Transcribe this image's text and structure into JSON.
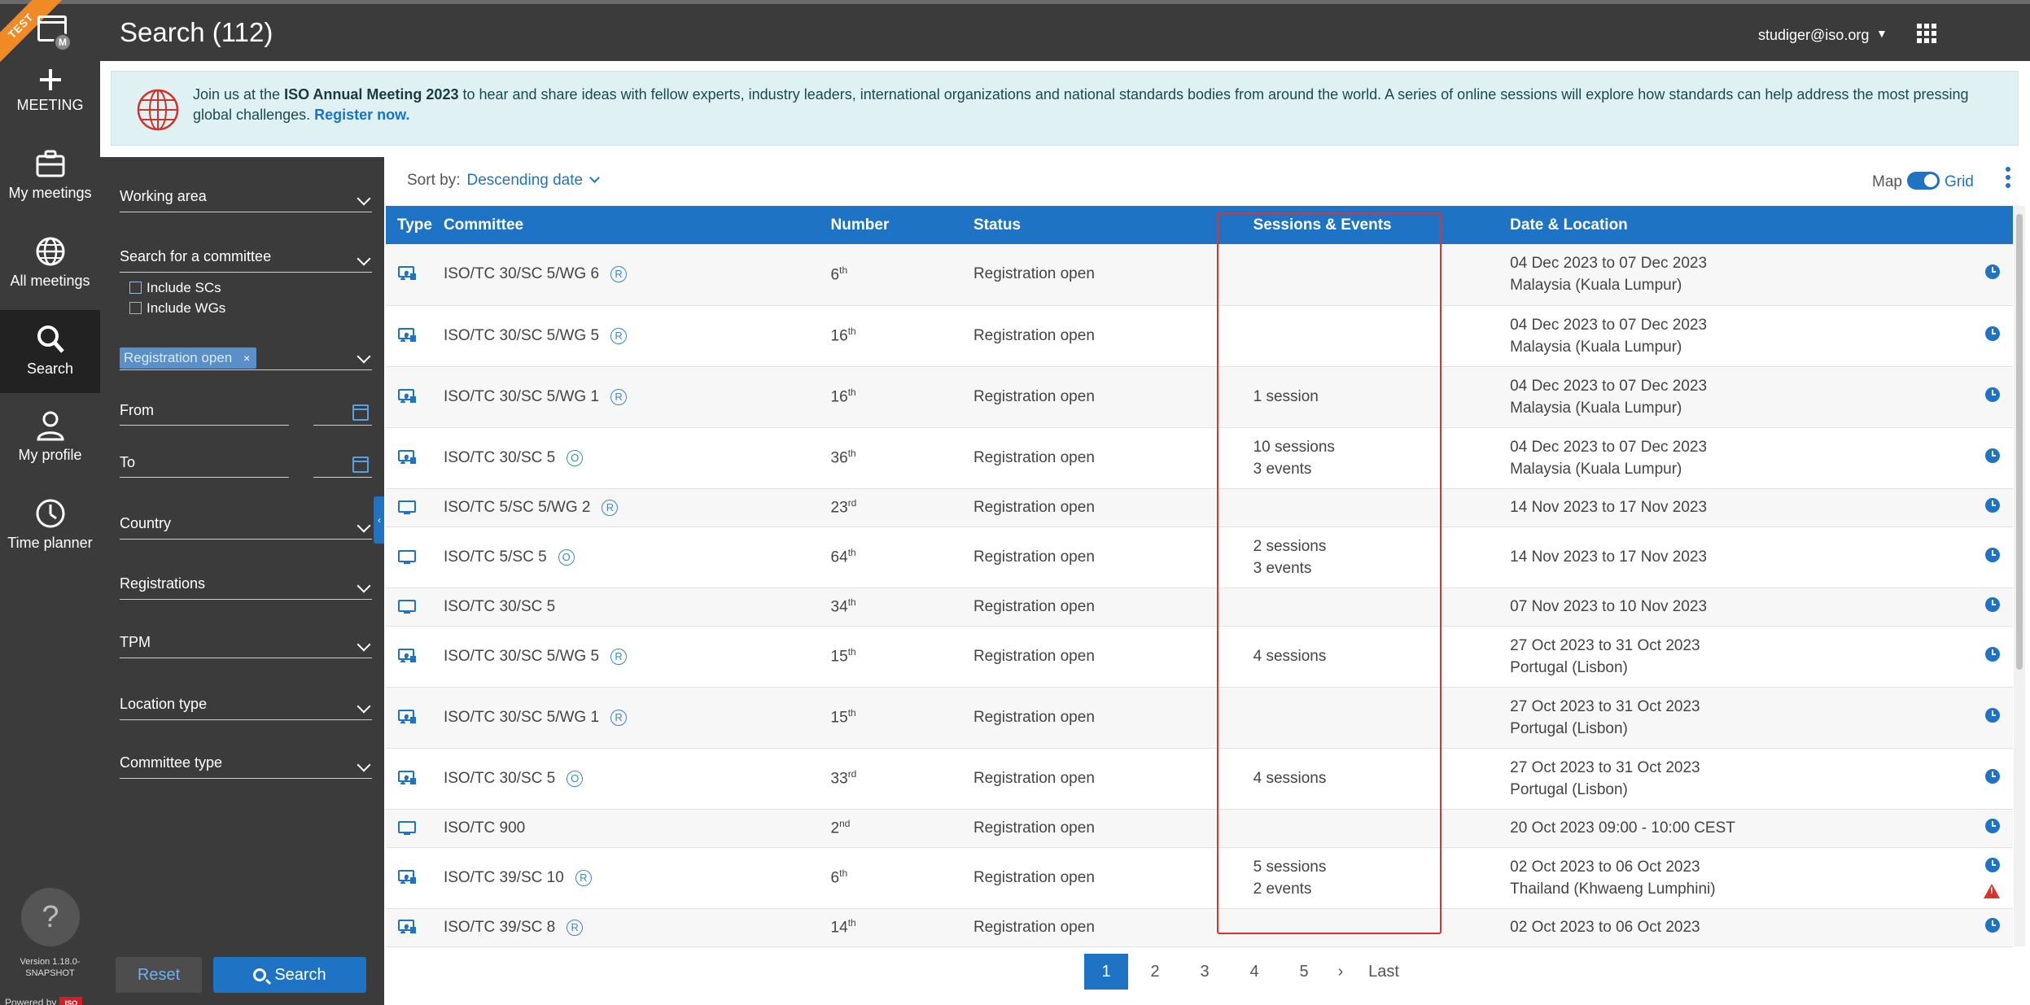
{
  "env_badge": "TEST",
  "topbar": {
    "title": "Search (112)",
    "user": "studiger@iso.org"
  },
  "rail": {
    "logo_badge": "M",
    "items": [
      {
        "label": "MEETING",
        "icon": "plus-icon"
      },
      {
        "label": "My meetings",
        "icon": "briefcase-icon"
      },
      {
        "label": "All meetings",
        "icon": "globe-icon"
      },
      {
        "label": "Search",
        "icon": "search-icon"
      },
      {
        "label": "My profile",
        "icon": "person-icon"
      },
      {
        "label": "Time planner",
        "icon": "clock-icon"
      }
    ],
    "help": "?",
    "version": "Version 1.18.0-SNAPSHOT",
    "powered_by": "Powered by",
    "powered_brand": "ISO"
  },
  "banner": {
    "prefix": "Join us at the ",
    "event": "ISO Annual Meeting 2023",
    "body": " to hear and share ideas with fellow experts, industry leaders, international organizations and national standards bodies from around the world. A series of online sessions will explore how standards can help address the most pressing global challenges. ",
    "link": "Register now."
  },
  "filters": {
    "working_area": "Working area",
    "search_committee": "Search for a committee",
    "include_scs": "Include SCs",
    "include_wgs": "Include WGs",
    "status_chip": "Registration open",
    "chip_remove": "×",
    "from": "From",
    "to": "To",
    "country": "Country",
    "registrations": "Registrations",
    "tpm": "TPM",
    "location_type": "Location type",
    "committee_type": "Committee type",
    "reset": "Reset",
    "search": "Search"
  },
  "sort": {
    "label": "Sort by:",
    "value": "Descending date"
  },
  "view": {
    "map": "Map",
    "grid": "Grid"
  },
  "table": {
    "headers": [
      "Type",
      "Committee",
      "Number",
      "Status",
      "Sessions & Events",
      "Date & Location"
    ],
    "rows": [
      {
        "type": "hybrid",
        "committee": "ISO/TC 30/SC 5/WG 6",
        "badge": "R",
        "num": "6",
        "sup": "th",
        "status": "Registration open",
        "sessions": [],
        "date": "04 Dec 2023 to 07 Dec 2023",
        "location": "Malaysia (Kuala Lumpur)",
        "warn": false
      },
      {
        "type": "hybrid",
        "committee": "ISO/TC 30/SC 5/WG 5",
        "badge": "R",
        "num": "16",
        "sup": "th",
        "status": "Registration open",
        "sessions": [],
        "date": "04 Dec 2023 to 07 Dec 2023",
        "location": "Malaysia (Kuala Lumpur)",
        "warn": false
      },
      {
        "type": "hybrid",
        "committee": "ISO/TC 30/SC 5/WG 1",
        "badge": "R",
        "num": "16",
        "sup": "th",
        "status": "Registration open",
        "sessions": [
          "1 session"
        ],
        "date": "04 Dec 2023 to 07 Dec 2023",
        "location": "Malaysia (Kuala Lumpur)",
        "warn": false
      },
      {
        "type": "hybrid",
        "committee": "ISO/TC 30/SC 5",
        "badge": "O",
        "num": "36",
        "sup": "th",
        "status": "Registration open",
        "sessions": [
          "10 sessions",
          "3 events"
        ],
        "date": "04 Dec 2023 to 07 Dec 2023",
        "location": "Malaysia (Kuala Lumpur)",
        "warn": false
      },
      {
        "type": "online",
        "committee": "ISO/TC 5/SC 5/WG 2",
        "badge": "R",
        "num": "23",
        "sup": "rd",
        "status": "Registration open",
        "sessions": [],
        "date": "14 Nov 2023 to 17 Nov 2023",
        "location": "",
        "warn": false
      },
      {
        "type": "online",
        "committee": "ISO/TC 5/SC 5",
        "badge": "O",
        "num": "64",
        "sup": "th",
        "status": "Registration open",
        "sessions": [
          "2 sessions",
          "3 events"
        ],
        "date": "14 Nov 2023 to 17 Nov 2023",
        "location": "",
        "warn": false
      },
      {
        "type": "online",
        "committee": "ISO/TC 30/SC 5",
        "badge": "",
        "num": "34",
        "sup": "th",
        "status": "Registration open",
        "sessions": [],
        "date": "07 Nov 2023 to 10 Nov 2023",
        "location": "",
        "warn": false
      },
      {
        "type": "hybrid",
        "committee": "ISO/TC 30/SC 5/WG 5",
        "badge": "R",
        "num": "15",
        "sup": "th",
        "status": "Registration open",
        "sessions": [
          "4 sessions"
        ],
        "date": "27 Oct 2023 to 31 Oct 2023",
        "location": "Portugal (Lisbon)",
        "warn": false
      },
      {
        "type": "hybrid",
        "committee": "ISO/TC 30/SC 5/WG 1",
        "badge": "R",
        "num": "15",
        "sup": "th",
        "status": "Registration open",
        "sessions": [],
        "date": "27 Oct 2023 to 31 Oct 2023",
        "location": "Portugal (Lisbon)",
        "warn": false
      },
      {
        "type": "hybrid",
        "committee": "ISO/TC 30/SC 5",
        "badge": "O",
        "num": "33",
        "sup": "rd",
        "status": "Registration open",
        "sessions": [
          "4 sessions"
        ],
        "date": "27 Oct 2023 to 31 Oct 2023",
        "location": "Portugal (Lisbon)",
        "warn": false
      },
      {
        "type": "online",
        "committee": "ISO/TC 900",
        "badge": "",
        "num": "2",
        "sup": "nd",
        "status": "Registration open",
        "sessions": [],
        "date": "20 Oct 2023 09:00 - 10:00 CEST",
        "location": "",
        "warn": false
      },
      {
        "type": "hybrid",
        "committee": "ISO/TC 39/SC 10",
        "badge": "R",
        "num": "6",
        "sup": "th",
        "status": "Registration open",
        "sessions": [
          "5 sessions",
          "2 events"
        ],
        "date": "02 Oct 2023 to 06 Oct 2023",
        "location": "Thailand (Khwaeng Lumphini)",
        "warn": true
      },
      {
        "type": "hybrid",
        "committee": "ISO/TC 39/SC 8",
        "badge": "R",
        "num": "14",
        "sup": "th",
        "status": "Registration open",
        "sessions": [],
        "date": "02 Oct 2023 to 06 Oct 2023",
        "location": "",
        "warn": false
      }
    ]
  },
  "pagination": {
    "pages": [
      "1",
      "2",
      "3",
      "4",
      "5"
    ],
    "current": "1",
    "next": "›",
    "last": "Last"
  },
  "colors": {
    "accent": "#1f73c4",
    "dark": "#3b3b3b",
    "banner": "#dff1f3",
    "highlight": "#e03131",
    "test_ribbon": "#f08a24"
  }
}
